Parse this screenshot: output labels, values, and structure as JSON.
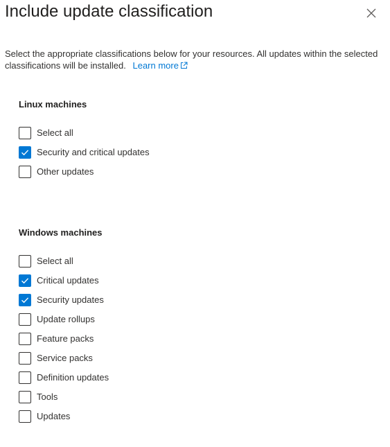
{
  "panel": {
    "title": "Include update classification",
    "close_icon": "close-icon",
    "description": "Select the appropriate classifications below for your resources. All updates within the selected classifications will be installed.",
    "learn_more_label": "Learn more",
    "learn_more_icon": "external-link-icon",
    "accent_color": "#0078d4"
  },
  "linux": {
    "heading": "Linux machines",
    "options": [
      {
        "label": "Select all",
        "checked": false
      },
      {
        "label": "Security and critical updates",
        "checked": true
      },
      {
        "label": "Other updates",
        "checked": false
      }
    ]
  },
  "windows": {
    "heading": "Windows machines",
    "options": [
      {
        "label": "Select all",
        "checked": false
      },
      {
        "label": "Critical updates",
        "checked": true
      },
      {
        "label": "Security updates",
        "checked": true
      },
      {
        "label": "Update rollups",
        "checked": false
      },
      {
        "label": "Feature packs",
        "checked": false
      },
      {
        "label": "Service packs",
        "checked": false
      },
      {
        "label": "Definition updates",
        "checked": false
      },
      {
        "label": "Tools",
        "checked": false
      },
      {
        "label": "Updates",
        "checked": false
      }
    ]
  }
}
